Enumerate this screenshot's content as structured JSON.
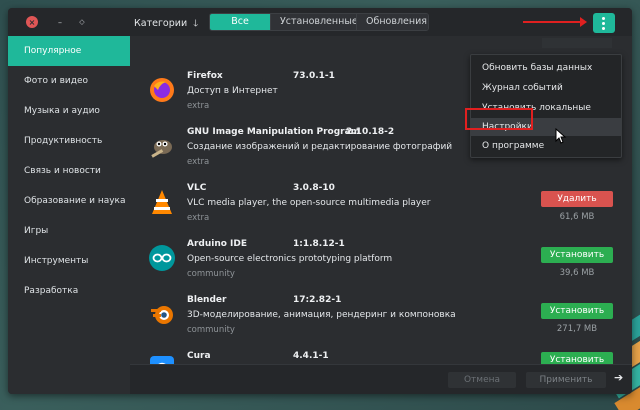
{
  "titlebar": {
    "categories_label": "Категории",
    "tabs": [
      {
        "label": "Все",
        "active": true
      },
      {
        "label": "Установленные",
        "active": false
      },
      {
        "label": "Обновления",
        "active": false
      }
    ]
  },
  "sidebar": {
    "items": [
      {
        "label": "Популярное",
        "active": true
      },
      {
        "label": "Фото и видео"
      },
      {
        "label": "Музыка и аудио"
      },
      {
        "label": "Продуктивность"
      },
      {
        "label": "Связь и новости"
      },
      {
        "label": "Образование и наука"
      },
      {
        "label": "Игры"
      },
      {
        "label": "Инструменты"
      },
      {
        "label": "Разработка"
      }
    ]
  },
  "apps": [
    {
      "name": "Firefox",
      "version": "73.0.1-1",
      "description": "Доступ в Интернет",
      "repo": "extra",
      "icon": "firefox-icon"
    },
    {
      "name": "GNU Image Manipulation Program",
      "version": "2.10.18-2",
      "description": "Создание изображений и редактирование фотографий",
      "repo": "extra",
      "icon": "gimp-icon"
    },
    {
      "name": "VLC",
      "version": "3.0.8-10",
      "description": "VLC media player, the open-source multimedia player",
      "repo": "extra",
      "action": "Удалить",
      "size": "61,6 MB",
      "icon": "vlc-icon"
    },
    {
      "name": "Arduino IDE",
      "version": "1:1.8.12-1",
      "description": "Open-source electronics prototyping platform",
      "repo": "community",
      "action": "Установить",
      "size": "39,6 MB",
      "icon": "arduino-icon"
    },
    {
      "name": "Blender",
      "version": "17:2.82-1",
      "description": "3D-моделирование, анимация, рендеринг и компоновка",
      "repo": "community",
      "action": "Установить",
      "size": "271,7 MB",
      "icon": "blender-icon"
    },
    {
      "name": "Cura",
      "version": "4.4.1-1",
      "description": "",
      "repo": "",
      "action": "Установить",
      "size": "",
      "icon": "cura-icon"
    }
  ],
  "dropdown": {
    "items": [
      {
        "label": "Обновить базы данных"
      },
      {
        "label": "Журнал событий"
      },
      {
        "label": "Установить локальные пакеты"
      },
      {
        "label": "Настройки",
        "highlighted": true
      },
      {
        "label": "О программе"
      }
    ]
  },
  "partial_text": "С",
  "bottombar": {
    "cancel_label": "Отмена",
    "apply_label": "Применить"
  },
  "colors": {
    "accent": "#1fb89a",
    "remove": "#d9534f",
    "install": "#2cae51",
    "annotation": "#e02020"
  }
}
